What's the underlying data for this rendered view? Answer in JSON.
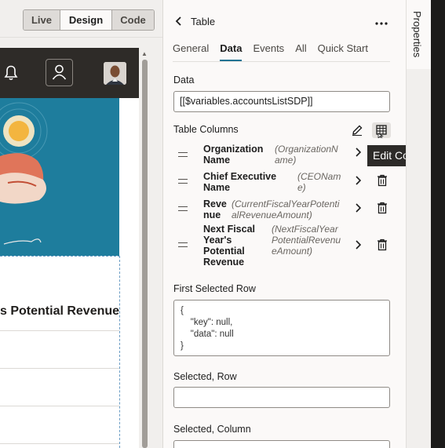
{
  "toolbar": {
    "modes": [
      "Live",
      "Design",
      "Code"
    ],
    "active_mode": "Design"
  },
  "preview": {
    "column_header": "s Potential Revenue"
  },
  "panel": {
    "title": "Table",
    "side_tab": "Properties",
    "tabs": [
      "General",
      "Data",
      "Events",
      "All",
      "Quick Start"
    ],
    "active_tab": "Data",
    "data_label": "Data",
    "data_value": "[[$variables.accountsListSDP]]",
    "table_columns_label": "Table Columns",
    "tooltip": "Edit Columns",
    "columns": [
      {
        "name_lines": [
          "Organization",
          "Name"
        ],
        "field_lines": [
          "(OrganizationN",
          "ame)"
        ]
      },
      {
        "name_lines": [
          "Chief Executive",
          "Name"
        ],
        "field_lines": [
          "(CEONam",
          "e)"
        ]
      },
      {
        "name_lines": [
          "Reve",
          "nue"
        ],
        "field_lines": [
          "(CurrentFiscalYearPotenti",
          "alRevenueAmount)"
        ]
      },
      {
        "name_lines": [
          "Next Fiscal",
          "Year's",
          "Potential",
          "Revenue"
        ],
        "field_lines": [
          "(NextFiscalYear",
          "PotentialRevenu",
          "eAmount)"
        ]
      }
    ],
    "first_selected_row_label": "First Selected Row",
    "first_selected_row_value": "{\n    \"key\": null,\n    \"data\": null\n}",
    "selected_row_label": "Selected, Row",
    "selected_row_value": "",
    "selected_column_label": "Selected, Column",
    "selected_column_value": ""
  },
  "colors": {
    "accent": "#227393",
    "header_dark": "#2e2b28",
    "hero_blue": "#1e7d9d",
    "tooltip_bg": "#2d2b29"
  },
  "icons": {
    "notifications": "bell-icon",
    "user": "user-icon",
    "back": "chevron-left-icon",
    "more": "more-horizontal-icon",
    "edit": "pencil-icon",
    "edit_columns": "table-edit-icon",
    "drag": "drag-handle-icon",
    "navigate": "chevron-right-icon",
    "delete": "trash-icon"
  }
}
